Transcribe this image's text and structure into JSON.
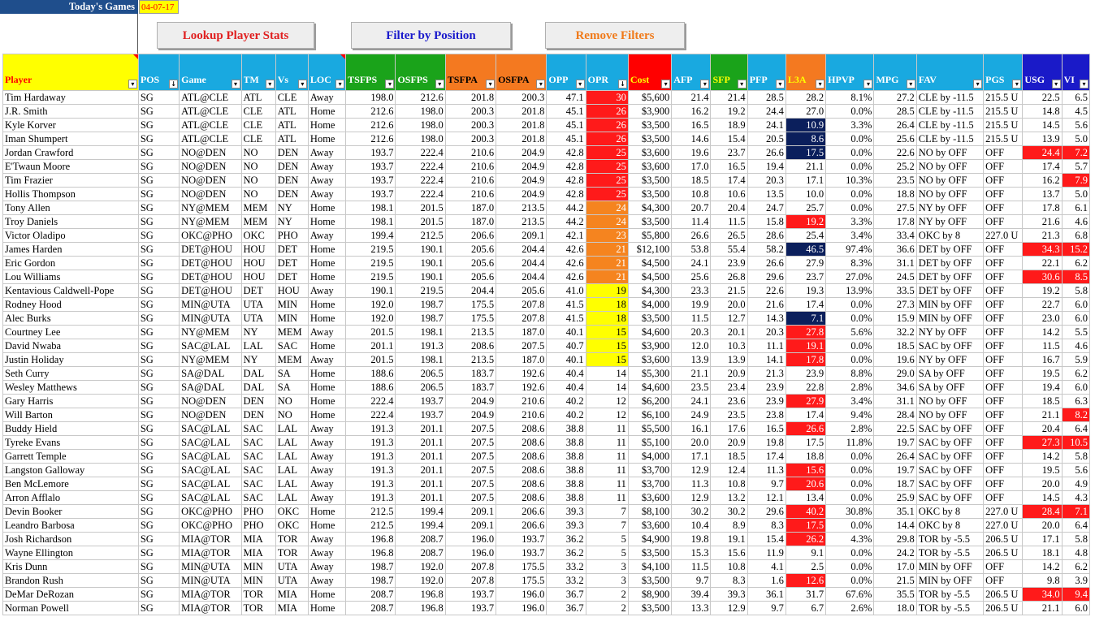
{
  "top": {
    "title": "Today's Games",
    "date": "04-07-17",
    "buttons": {
      "lookup": "Lookup Player Stats",
      "filter": "Filter by Position",
      "remove": "Remove Filters"
    }
  },
  "colors": {
    "blue_header": "#19a9e0",
    "green_header": "#1aa31a",
    "orange_header": "#f47920",
    "red_header": "#ff0000",
    "yellow_header": "#ffff00",
    "navy_header": "#1a1ac8",
    "cell_red": "#ff1a1a",
    "cell_orange": "#f5841f",
    "cell_yellow": "#ffff00",
    "cell_navy": "#0b1f5c"
  },
  "columns": [
    {
      "label": "Player",
      "w": 166,
      "bg": "#ffff00",
      "fg": "#ff0000",
      "filter": "▾",
      "corner": true
    },
    {
      "label": "POS",
      "w": 50,
      "bg": "#19a9e0",
      "fg": "#ffffff",
      "filter": "↓"
    },
    {
      "label": "Game",
      "w": 76,
      "bg": "#19a9e0",
      "fg": "#ffffff",
      "filter": "▾"
    },
    {
      "label": "TM",
      "w": 42,
      "bg": "#19a9e0",
      "fg": "#ffffff",
      "filter": "▾"
    },
    {
      "label": "Vs",
      "w": 40,
      "bg": "#19a9e0",
      "fg": "#ffffff",
      "filter": "▾"
    },
    {
      "label": "LOC",
      "w": 46,
      "bg": "#19a9e0",
      "fg": "#ffffff",
      "filter": "▾",
      "corner": true
    },
    {
      "label": "TSFPS",
      "w": 61,
      "bg": "#1aa31a",
      "fg": "#ffffff",
      "filter": "▾"
    },
    {
      "label": "OSFPS",
      "w": 61,
      "bg": "#1aa31a",
      "fg": "#ffffff",
      "filter": "▾"
    },
    {
      "label": "TSFPA",
      "w": 62,
      "bg": "#f47920",
      "fg": "#000000",
      "filter": "▾"
    },
    {
      "label": "OSFPA",
      "w": 62,
      "bg": "#f47920",
      "fg": "#000000",
      "filter": "▾"
    },
    {
      "label": "OPP",
      "w": 48,
      "bg": "#19a9e0",
      "fg": "#ffffff",
      "filter": "▾"
    },
    {
      "label": "OPR",
      "w": 52,
      "bg": "#19a9e0",
      "fg": "#ffffff",
      "filter": "↓"
    },
    {
      "label": "Cost",
      "w": 53,
      "bg": "#ff0000",
      "fg": "#ffff00",
      "filter": "▾",
      "corner": true
    },
    {
      "label": "AFP",
      "w": 48,
      "bg": "#19a9e0",
      "fg": "#ffffff",
      "filter": "▾"
    },
    {
      "label": "SFP",
      "w": 45,
      "bg": "#1aa31a",
      "fg": "#ffff00",
      "filter": "▾"
    },
    {
      "label": "PFP",
      "w": 47,
      "bg": "#19a9e0",
      "fg": "#ffffff",
      "filter": "▾"
    },
    {
      "label": "L3A",
      "w": 49,
      "bg": "#f47920",
      "fg": "#ffff00",
      "filter": "▾"
    },
    {
      "label": "HPVP",
      "w": 59,
      "bg": "#19a9e0",
      "fg": "#ffffff",
      "filter": "▾"
    },
    {
      "label": "MPG",
      "w": 52,
      "bg": "#19a9e0",
      "fg": "#ffffff",
      "filter": "▾"
    },
    {
      "label": "FAV",
      "w": 82,
      "bg": "#19a9e0",
      "fg": "#ffffff",
      "filter": "▾"
    },
    {
      "label": "PGS",
      "w": 48,
      "bg": "#19a9e0",
      "fg": "#ffffff",
      "filter": "▾"
    },
    {
      "label": "USG",
      "w": 48,
      "bg": "#1a1ac8",
      "fg": "#ffffff",
      "filter": "▾"
    },
    {
      "label": "VI",
      "w": 34,
      "bg": "#1a1ac8",
      "fg": "#ffffff",
      "filter": "▾"
    }
  ],
  "rows": [
    [
      "Tim Hardaway",
      "SG",
      "ATL@CLE",
      "ATL",
      "CLE",
      "Away",
      "198.0",
      "212.6",
      "201.8",
      "200.3",
      "47.1",
      "30",
      "$5,600",
      "21.4",
      "21.4",
      "28.5",
      "28.2",
      "8.1%",
      "27.2",
      "CLE by -11.5",
      "215.5 U",
      "22.5",
      "6.5"
    ],
    [
      "J.R. Smith",
      "SG",
      "ATL@CLE",
      "CLE",
      "ATL",
      "Home",
      "212.6",
      "198.0",
      "200.3",
      "201.8",
      "45.1",
      "26",
      "$3,900",
      "16.2",
      "19.2",
      "24.4",
      "27.0",
      "0.0%",
      "28.5",
      "CLE by -11.5",
      "215.5 U",
      "14.8",
      "4.5"
    ],
    [
      "Kyle Korver",
      "SG",
      "ATL@CLE",
      "CLE",
      "ATL",
      "Home",
      "212.6",
      "198.0",
      "200.3",
      "201.8",
      "45.1",
      "26",
      "$3,500",
      "16.5",
      "18.9",
      "24.1",
      "10.9",
      "3.3%",
      "26.4",
      "CLE by -11.5",
      "215.5 U",
      "14.5",
      "5.6"
    ],
    [
      "Iman Shumpert",
      "SG",
      "ATL@CLE",
      "CLE",
      "ATL",
      "Home",
      "212.6",
      "198.0",
      "200.3",
      "201.8",
      "45.1",
      "26",
      "$3,500",
      "14.6",
      "15.4",
      "20.5",
      "8.6",
      "0.0%",
      "25.6",
      "CLE by -11.5",
      "215.5 U",
      "13.9",
      "5.0"
    ],
    [
      "Jordan Crawford",
      "SG",
      "NO@DEN",
      "NO",
      "DEN",
      "Away",
      "193.7",
      "222.4",
      "210.6",
      "204.9",
      "42.8",
      "25",
      "$3,600",
      "19.6",
      "23.7",
      "26.6",
      "17.5",
      "0.0%",
      "22.6",
      "NO by OFF",
      "OFF",
      "24.4",
      "7.2"
    ],
    [
      "E'Twaun Moore",
      "SG",
      "NO@DEN",
      "NO",
      "DEN",
      "Away",
      "193.7",
      "222.4",
      "210.6",
      "204.9",
      "42.8",
      "25",
      "$3,600",
      "17.0",
      "16.5",
      "19.4",
      "21.1",
      "0.0%",
      "25.2",
      "NO by OFF",
      "OFF",
      "17.4",
      "5.7"
    ],
    [
      "Tim Frazier",
      "SG",
      "NO@DEN",
      "NO",
      "DEN",
      "Away",
      "193.7",
      "222.4",
      "210.6",
      "204.9",
      "42.8",
      "25",
      "$3,500",
      "18.5",
      "17.4",
      "20.3",
      "17.1",
      "10.3%",
      "23.5",
      "NO by OFF",
      "OFF",
      "16.2",
      "7.9"
    ],
    [
      "Hollis Thompson",
      "SG",
      "NO@DEN",
      "NO",
      "DEN",
      "Away",
      "193.7",
      "222.4",
      "210.6",
      "204.9",
      "42.8",
      "25",
      "$3,500",
      "10.8",
      "10.6",
      "13.5",
      "10.0",
      "0.0%",
      "18.8",
      "NO by OFF",
      "OFF",
      "13.7",
      "5.0"
    ],
    [
      "Tony Allen",
      "SG",
      "NY@MEM",
      "MEM",
      "NY",
      "Home",
      "198.1",
      "201.5",
      "187.0",
      "213.5",
      "44.2",
      "24",
      "$4,300",
      "20.7",
      "20.4",
      "24.7",
      "25.7",
      "0.0%",
      "27.5",
      "NY by OFF",
      "OFF",
      "17.8",
      "6.1"
    ],
    [
      "Troy Daniels",
      "SG",
      "NY@MEM",
      "MEM",
      "NY",
      "Home",
      "198.1",
      "201.5",
      "187.0",
      "213.5",
      "44.2",
      "24",
      "$3,500",
      "11.4",
      "11.5",
      "15.8",
      "19.2",
      "3.3%",
      "17.8",
      "NY by OFF",
      "OFF",
      "21.6",
      "4.6"
    ],
    [
      "Victor Oladipo",
      "SG",
      "OKC@PHO",
      "OKC",
      "PHO",
      "Away",
      "199.4",
      "212.5",
      "206.6",
      "209.1",
      "42.1",
      "23",
      "$5,800",
      "26.6",
      "26.5",
      "28.6",
      "25.4",
      "3.4%",
      "33.4",
      "OKC by 8",
      "227.0 U",
      "21.3",
      "6.8"
    ],
    [
      "James Harden",
      "SG",
      "DET@HOU",
      "HOU",
      "DET",
      "Home",
      "219.5",
      "190.1",
      "205.6",
      "204.4",
      "42.6",
      "21",
      "$12,100",
      "53.8",
      "55.4",
      "58.2",
      "46.5",
      "97.4%",
      "36.6",
      "DET by OFF",
      "OFF",
      "34.3",
      "15.2"
    ],
    [
      "Eric Gordon",
      "SG",
      "DET@HOU",
      "HOU",
      "DET",
      "Home",
      "219.5",
      "190.1",
      "205.6",
      "204.4",
      "42.6",
      "21",
      "$4,500",
      "24.1",
      "23.9",
      "26.6",
      "27.9",
      "8.3%",
      "31.1",
      "DET by OFF",
      "OFF",
      "22.1",
      "6.2"
    ],
    [
      "Lou Williams",
      "SG",
      "DET@HOU",
      "HOU",
      "DET",
      "Home",
      "219.5",
      "190.1",
      "205.6",
      "204.4",
      "42.6",
      "21",
      "$4,500",
      "25.6",
      "26.8",
      "29.6",
      "23.7",
      "27.0%",
      "24.5",
      "DET by OFF",
      "OFF",
      "30.6",
      "8.5"
    ],
    [
      "Kentavious Caldwell-Pope",
      "SG",
      "DET@HOU",
      "DET",
      "HOU",
      "Away",
      "190.1",
      "219.5",
      "204.4",
      "205.6",
      "41.0",
      "19",
      "$4,300",
      "23.3",
      "21.5",
      "22.6",
      "19.3",
      "13.9%",
      "33.5",
      "DET by OFF",
      "OFF",
      "19.2",
      "5.8"
    ],
    [
      "Rodney Hood",
      "SG",
      "MIN@UTA",
      "UTA",
      "MIN",
      "Home",
      "192.0",
      "198.7",
      "175.5",
      "207.8",
      "41.5",
      "18",
      "$4,000",
      "19.9",
      "20.0",
      "21.6",
      "17.4",
      "0.0%",
      "27.3",
      "MIN by OFF",
      "OFF",
      "22.7",
      "6.0"
    ],
    [
      "Alec Burks",
      "SG",
      "MIN@UTA",
      "UTA",
      "MIN",
      "Home",
      "192.0",
      "198.7",
      "175.5",
      "207.8",
      "41.5",
      "18",
      "$3,500",
      "11.5",
      "12.7",
      "14.3",
      "7.1",
      "0.0%",
      "15.9",
      "MIN by OFF",
      "OFF",
      "23.0",
      "6.0"
    ],
    [
      "Courtney Lee",
      "SG",
      "NY@MEM",
      "NY",
      "MEM",
      "Away",
      "201.5",
      "198.1",
      "213.5",
      "187.0",
      "40.1",
      "15",
      "$4,600",
      "20.3",
      "20.1",
      "20.3",
      "27.8",
      "5.6%",
      "32.2",
      "NY by OFF",
      "OFF",
      "14.2",
      "5.5"
    ],
    [
      "David Nwaba",
      "SG",
      "SAC@LAL",
      "LAL",
      "SAC",
      "Home",
      "201.1",
      "191.3",
      "208.6",
      "207.5",
      "40.7",
      "15",
      "$3,900",
      "12.0",
      "10.3",
      "11.1",
      "19.1",
      "0.0%",
      "18.5",
      "SAC by OFF",
      "OFF",
      "11.5",
      "4.6"
    ],
    [
      "Justin Holiday",
      "SG",
      "NY@MEM",
      "NY",
      "MEM",
      "Away",
      "201.5",
      "198.1",
      "213.5",
      "187.0",
      "40.1",
      "15",
      "$3,600",
      "13.9",
      "13.9",
      "14.1",
      "17.8",
      "0.0%",
      "19.6",
      "NY by OFF",
      "OFF",
      "16.7",
      "5.9"
    ],
    [
      "Seth Curry",
      "SG",
      "SA@DAL",
      "DAL",
      "SA",
      "Home",
      "188.6",
      "206.5",
      "183.7",
      "192.6",
      "40.4",
      "14",
      "$5,300",
      "21.1",
      "20.9",
      "21.3",
      "23.9",
      "8.8%",
      "29.0",
      "SA by OFF",
      "OFF",
      "19.5",
      "6.2"
    ],
    [
      "Wesley Matthews",
      "SG",
      "SA@DAL",
      "DAL",
      "SA",
      "Home",
      "188.6",
      "206.5",
      "183.7",
      "192.6",
      "40.4",
      "14",
      "$4,600",
      "23.5",
      "23.4",
      "23.9",
      "22.8",
      "2.8%",
      "34.6",
      "SA by OFF",
      "OFF",
      "19.4",
      "6.0"
    ],
    [
      "Gary Harris",
      "SG",
      "NO@DEN",
      "DEN",
      "NO",
      "Home",
      "222.4",
      "193.7",
      "204.9",
      "210.6",
      "40.2",
      "12",
      "$6,200",
      "24.1",
      "23.6",
      "23.9",
      "27.9",
      "3.4%",
      "31.1",
      "NO by OFF",
      "OFF",
      "18.5",
      "6.3"
    ],
    [
      "Will Barton",
      "SG",
      "NO@DEN",
      "DEN",
      "NO",
      "Home",
      "222.4",
      "193.7",
      "204.9",
      "210.6",
      "40.2",
      "12",
      "$6,100",
      "24.9",
      "23.5",
      "23.8",
      "17.4",
      "9.4%",
      "28.4",
      "NO by OFF",
      "OFF",
      "21.1",
      "8.2"
    ],
    [
      "Buddy Hield",
      "SG",
      "SAC@LAL",
      "SAC",
      "LAL",
      "Away",
      "191.3",
      "201.1",
      "207.5",
      "208.6",
      "38.8",
      "11",
      "$5,500",
      "16.1",
      "17.6",
      "16.5",
      "26.6",
      "2.8%",
      "22.5",
      "SAC by OFF",
      "OFF",
      "20.4",
      "6.4"
    ],
    [
      "Tyreke Evans",
      "SG",
      "SAC@LAL",
      "SAC",
      "LAL",
      "Away",
      "191.3",
      "201.1",
      "207.5",
      "208.6",
      "38.8",
      "11",
      "$5,100",
      "20.0",
      "20.9",
      "19.8",
      "17.5",
      "11.8%",
      "19.7",
      "SAC by OFF",
      "OFF",
      "27.3",
      "10.5"
    ],
    [
      "Garrett Temple",
      "SG",
      "SAC@LAL",
      "SAC",
      "LAL",
      "Away",
      "191.3",
      "201.1",
      "207.5",
      "208.6",
      "38.8",
      "11",
      "$4,000",
      "17.1",
      "18.5",
      "17.4",
      "18.8",
      "0.0%",
      "26.4",
      "SAC by OFF",
      "OFF",
      "14.2",
      "5.8"
    ],
    [
      "Langston Galloway",
      "SG",
      "SAC@LAL",
      "SAC",
      "LAL",
      "Away",
      "191.3",
      "201.1",
      "207.5",
      "208.6",
      "38.8",
      "11",
      "$3,700",
      "12.9",
      "12.4",
      "11.3",
      "15.6",
      "0.0%",
      "19.7",
      "SAC by OFF",
      "OFF",
      "19.5",
      "5.6"
    ],
    [
      "Ben McLemore",
      "SG",
      "SAC@LAL",
      "SAC",
      "LAL",
      "Away",
      "191.3",
      "201.1",
      "207.5",
      "208.6",
      "38.8",
      "11",
      "$3,700",
      "11.3",
      "10.8",
      "9.7",
      "20.6",
      "0.0%",
      "18.7",
      "SAC by OFF",
      "OFF",
      "20.0",
      "4.9"
    ],
    [
      "Arron Afflalo",
      "SG",
      "SAC@LAL",
      "SAC",
      "LAL",
      "Away",
      "191.3",
      "201.1",
      "207.5",
      "208.6",
      "38.8",
      "11",
      "$3,600",
      "12.9",
      "13.2",
      "12.1",
      "13.4",
      "0.0%",
      "25.9",
      "SAC by OFF",
      "OFF",
      "14.5",
      "4.3"
    ],
    [
      "Devin Booker",
      "SG",
      "OKC@PHO",
      "PHO",
      "OKC",
      "Home",
      "212.5",
      "199.4",
      "209.1",
      "206.6",
      "39.3",
      "7",
      "$8,100",
      "30.2",
      "30.2",
      "29.6",
      "40.2",
      "30.8%",
      "35.1",
      "OKC by 8",
      "227.0 U",
      "28.4",
      "7.1"
    ],
    [
      "Leandro Barbosa",
      "SG",
      "OKC@PHO",
      "PHO",
      "OKC",
      "Home",
      "212.5",
      "199.4",
      "209.1",
      "206.6",
      "39.3",
      "7",
      "$3,600",
      "10.4",
      "8.9",
      "8.3",
      "17.5",
      "0.0%",
      "14.4",
      "OKC by 8",
      "227.0 U",
      "20.0",
      "6.4"
    ],
    [
      "Josh Richardson",
      "SG",
      "MIA@TOR",
      "MIA",
      "TOR",
      "Away",
      "196.8",
      "208.7",
      "196.0",
      "193.7",
      "36.2",
      "5",
      "$4,900",
      "19.8",
      "19.1",
      "15.4",
      "26.2",
      "4.3%",
      "29.8",
      "TOR by -5.5",
      "206.5 U",
      "17.1",
      "5.8"
    ],
    [
      "Wayne Ellington",
      "SG",
      "MIA@TOR",
      "MIA",
      "TOR",
      "Away",
      "196.8",
      "208.7",
      "196.0",
      "193.7",
      "36.2",
      "5",
      "$3,500",
      "15.3",
      "15.6",
      "11.9",
      "9.1",
      "0.0%",
      "24.2",
      "TOR by -5.5",
      "206.5 U",
      "18.1",
      "4.8"
    ],
    [
      "Kris Dunn",
      "SG",
      "MIN@UTA",
      "MIN",
      "UTA",
      "Away",
      "198.7",
      "192.0",
      "207.8",
      "175.5",
      "33.2",
      "3",
      "$4,100",
      "11.5",
      "10.8",
      "4.1",
      "2.5",
      "0.0%",
      "17.0",
      "MIN by OFF",
      "OFF",
      "14.2",
      "6.2"
    ],
    [
      "Brandon Rush",
      "SG",
      "MIN@UTA",
      "MIN",
      "UTA",
      "Away",
      "198.7",
      "192.0",
      "207.8",
      "175.5",
      "33.2",
      "3",
      "$3,500",
      "9.7",
      "8.3",
      "1.6",
      "12.6",
      "0.0%",
      "21.5",
      "MIN by OFF",
      "OFF",
      "9.8",
      "3.9"
    ],
    [
      "DeMar DeRozan",
      "SG",
      "MIA@TOR",
      "TOR",
      "MIA",
      "Home",
      "208.7",
      "196.8",
      "193.7",
      "196.0",
      "36.7",
      "2",
      "$8,900",
      "39.4",
      "39.3",
      "36.1",
      "31.7",
      "67.6%",
      "35.5",
      "TOR by -5.5",
      "206.5 U",
      "34.0",
      "9.4"
    ],
    [
      "Norman Powell",
      "SG",
      "MIA@TOR",
      "TOR",
      "MIA",
      "Home",
      "208.7",
      "196.8",
      "193.7",
      "196.0",
      "36.7",
      "2",
      "$3,500",
      "13.3",
      "12.9",
      "9.7",
      "6.7",
      "2.6%",
      "18.0",
      "TOR by -5.5",
      "206.5 U",
      "21.1",
      "6.0"
    ]
  ]
}
